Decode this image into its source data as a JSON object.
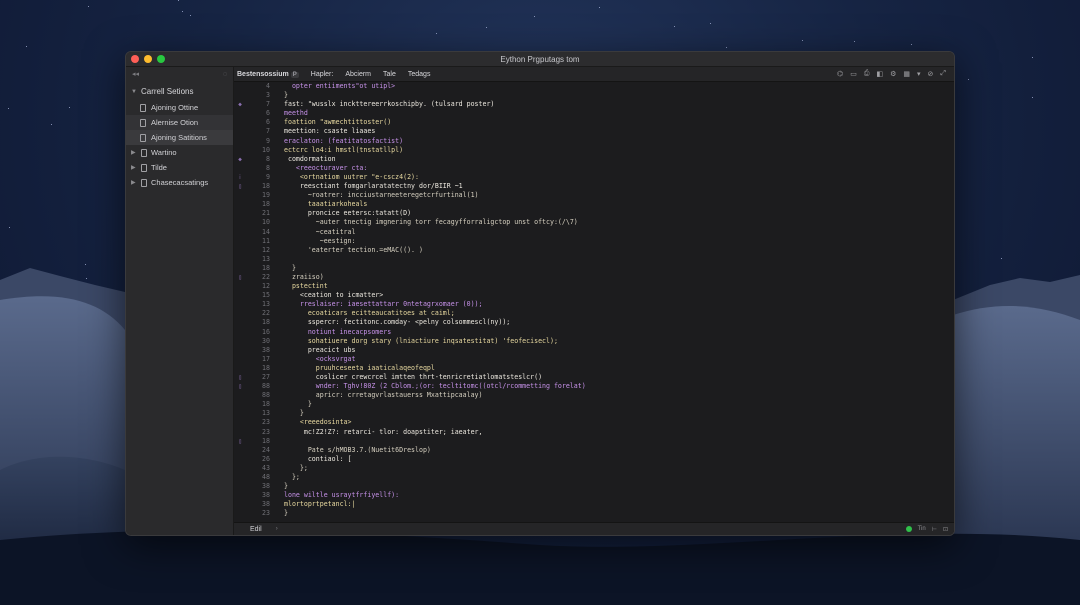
{
  "window": {
    "title": "Eython Prgputags tom"
  },
  "sidebar": {
    "section": "Carrell Setions",
    "items": [
      {
        "label": "Ajoning Ottine"
      },
      {
        "label": "Alernise Otion"
      },
      {
        "label": "Ajoning Satitions"
      }
    ],
    "groups": [
      {
        "label": "Wartino"
      },
      {
        "label": "Tilde"
      },
      {
        "label": "Chasecacsatings"
      }
    ]
  },
  "toolbar": {
    "items": [
      "Bestensossium",
      "Hapler:",
      "Abcierm",
      "Tale",
      "Tedags"
    ],
    "badge": "P",
    "icons": [
      "share-icon",
      "panel-icon",
      "print-icon",
      "tag-icon",
      "settings-icon",
      "grid-icon",
      "chevron-down-icon",
      "hide-icon",
      "expand-icon"
    ]
  },
  "code": {
    "lines": [
      {
        "n": "4",
        "t": "  opter entiiments\"ot utipl>"
      },
      {
        "n": "3",
        "t": "}"
      },
      {
        "n": "7",
        "t": "fast: \"wusslx inckttereerrkoschipby. (tulsard poster)"
      },
      {
        "n": "6",
        "t": "meethd"
      },
      {
        "n": "6",
        "t": "foattion \"awmechtittoster()"
      },
      {
        "n": "7",
        "t": "meettion: csaste liaaes"
      },
      {
        "n": "9",
        "t": "eraclaton: (featitatosfactist)"
      },
      {
        "n": "10",
        "t": "ectcrc lo4:i hmstl(tnstatllpl)"
      },
      {
        "n": "8",
        "t": " comdormation"
      },
      {
        "n": "8",
        "t": "   <reeocturaver cta:"
      },
      {
        "n": "9",
        "t": "    <ortnatiom uutrer \"e-cscz4(2):"
      },
      {
        "n": "18",
        "t": "    reesctiant fomgarlaratatectny dor/BIIR ~1"
      },
      {
        "n": "19",
        "t": "      ~roatrer: incciustarneeteregetcrfurtinal(1)"
      },
      {
        "n": "18",
        "t": "      taaatiarkoheals"
      },
      {
        "n": "21",
        "t": "      proncice eetersc:tatatt(D)"
      },
      {
        "n": "10",
        "t": "        ~auter tnectig imgnering torr fecagyfforraligctop unst oftcy:(/\\7)"
      },
      {
        "n": "14",
        "t": "        ~ceatitral"
      },
      {
        "n": "11",
        "t": "         ~eestign:"
      },
      {
        "n": "12",
        "t": "      'eaterter tection.=eMAC((). )"
      },
      {
        "n": "13",
        "t": ""
      },
      {
        "n": "18",
        "t": "  }"
      },
      {
        "n": "22",
        "t": "  zraiiso)"
      },
      {
        "n": "12",
        "t": "  pstectint"
      },
      {
        "n": "15",
        "t": "    <ceation to icmatter>"
      },
      {
        "n": "13",
        "t": "    rreslaiser: iaesettattarr 0ntetagrxomaer (0));"
      },
      {
        "n": "22",
        "t": "      ecoaticars ecitteaucatitoes at caiml;"
      },
      {
        "n": "18",
        "t": "      sspercr: fectitonc.comday- <pelny colsommescl(ny));"
      },
      {
        "n": "16",
        "t": "      notiunt inecacpsomers"
      },
      {
        "n": "30",
        "t": "      sohatiuere dorg stary (lniactiure inqsatestitat) 'feofecisecl);"
      },
      {
        "n": "38",
        "t": "      preacict ubs"
      },
      {
        "n": "17",
        "t": "        <ocksvrgat"
      },
      {
        "n": "18",
        "t": "        pruuhceseeta iaaticalaqeofeqpl"
      },
      {
        "n": "27",
        "t": "        coslicer crewcrcel imtten thrt-tenricretiatlomatsteslcr()"
      },
      {
        "n": "88",
        "t": "        wnder: Tghv!80Z (2 Cblom.;(or: tecltitomc((otcl/rcommetting forelat)"
      },
      {
        "n": "88",
        "t": "        apricr: crretagvrlastauerss Mxattipcaalay)"
      },
      {
        "n": "18",
        "t": "      }"
      },
      {
        "n": "13",
        "t": "    }"
      },
      {
        "n": "23",
        "t": "    <reeedosinta>"
      },
      {
        "n": "23",
        "t": "     mc!Z2!Z?: retarci- tlor: doapstiter; iaeater,"
      },
      {
        "n": "18",
        "t": ""
      },
      {
        "n": "24",
        "t": "      Pate s/hMOB3.7.(Nuetit6Dreslop)"
      },
      {
        "n": "26",
        "t": "      contiaol: ["
      },
      {
        "n": "43",
        "t": "    };"
      },
      {
        "n": "48",
        "t": "  };"
      },
      {
        "n": "38",
        "t": "}"
      },
      {
        "n": "38",
        "t": "lone wiltle usraytfrfiyellf):"
      },
      {
        "n": "38",
        "t": "mlortoprtpetancl:|"
      },
      {
        "n": "23",
        "t": "}"
      }
    ]
  },
  "status": {
    "mode": "Edil",
    "right_label": "Tin"
  }
}
